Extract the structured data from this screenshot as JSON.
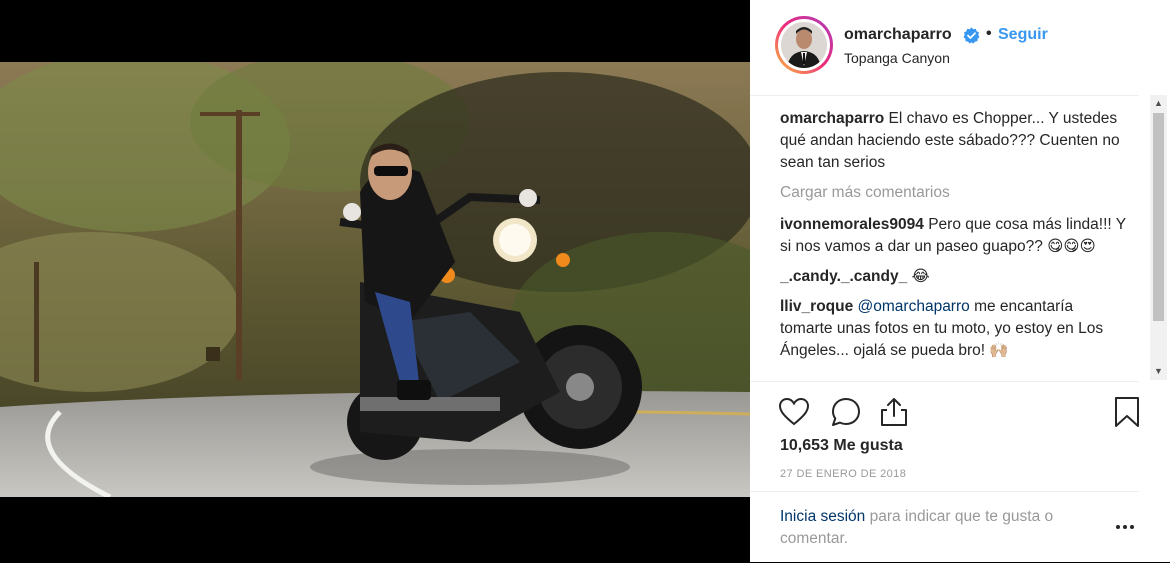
{
  "post": {
    "username": "omarchaparro",
    "separator": "•",
    "follow_label": "Seguir",
    "location": "Topanga Canyon"
  },
  "caption": {
    "username": "omarchaparro",
    "text": "El chavo es Chopper... Y ustedes qué andan haciendo este sábado??? Cuenten no sean tan serios"
  },
  "load_more_label": "Cargar más comentarios",
  "comments": [
    {
      "username": "ivonnemorales9094",
      "text": "Pero que cosa más linda!!! Y si nos vamos a dar un paseo guapo?? 😋😋😍"
    },
    {
      "username": "_.candy._.candy_",
      "text": "😂"
    },
    {
      "username": "lliv_roque",
      "mention": "@omarchaparro",
      "text": "me encantaría tomarte unas fotos en tu moto, yo estoy en Los Ángeles... ojalá se pueda bro! 🙌🏼"
    }
  ],
  "likes_label": "10,653 Me gusta",
  "date_label": "27 DE ENERO DE 2018",
  "footer": {
    "login_link": "Inicia sesión",
    "login_text": " para indicar que te gusta o comentar."
  },
  "icons": {
    "verified": "verified-badge-icon",
    "like": "heart-icon",
    "comment": "comment-bubble-icon",
    "share": "share-icon",
    "save": "bookmark-icon",
    "more": "more-options-icon"
  },
  "colors": {
    "link_blue": "#3897f0",
    "text": "#262626",
    "muted": "#999999",
    "mention": "#003569"
  }
}
